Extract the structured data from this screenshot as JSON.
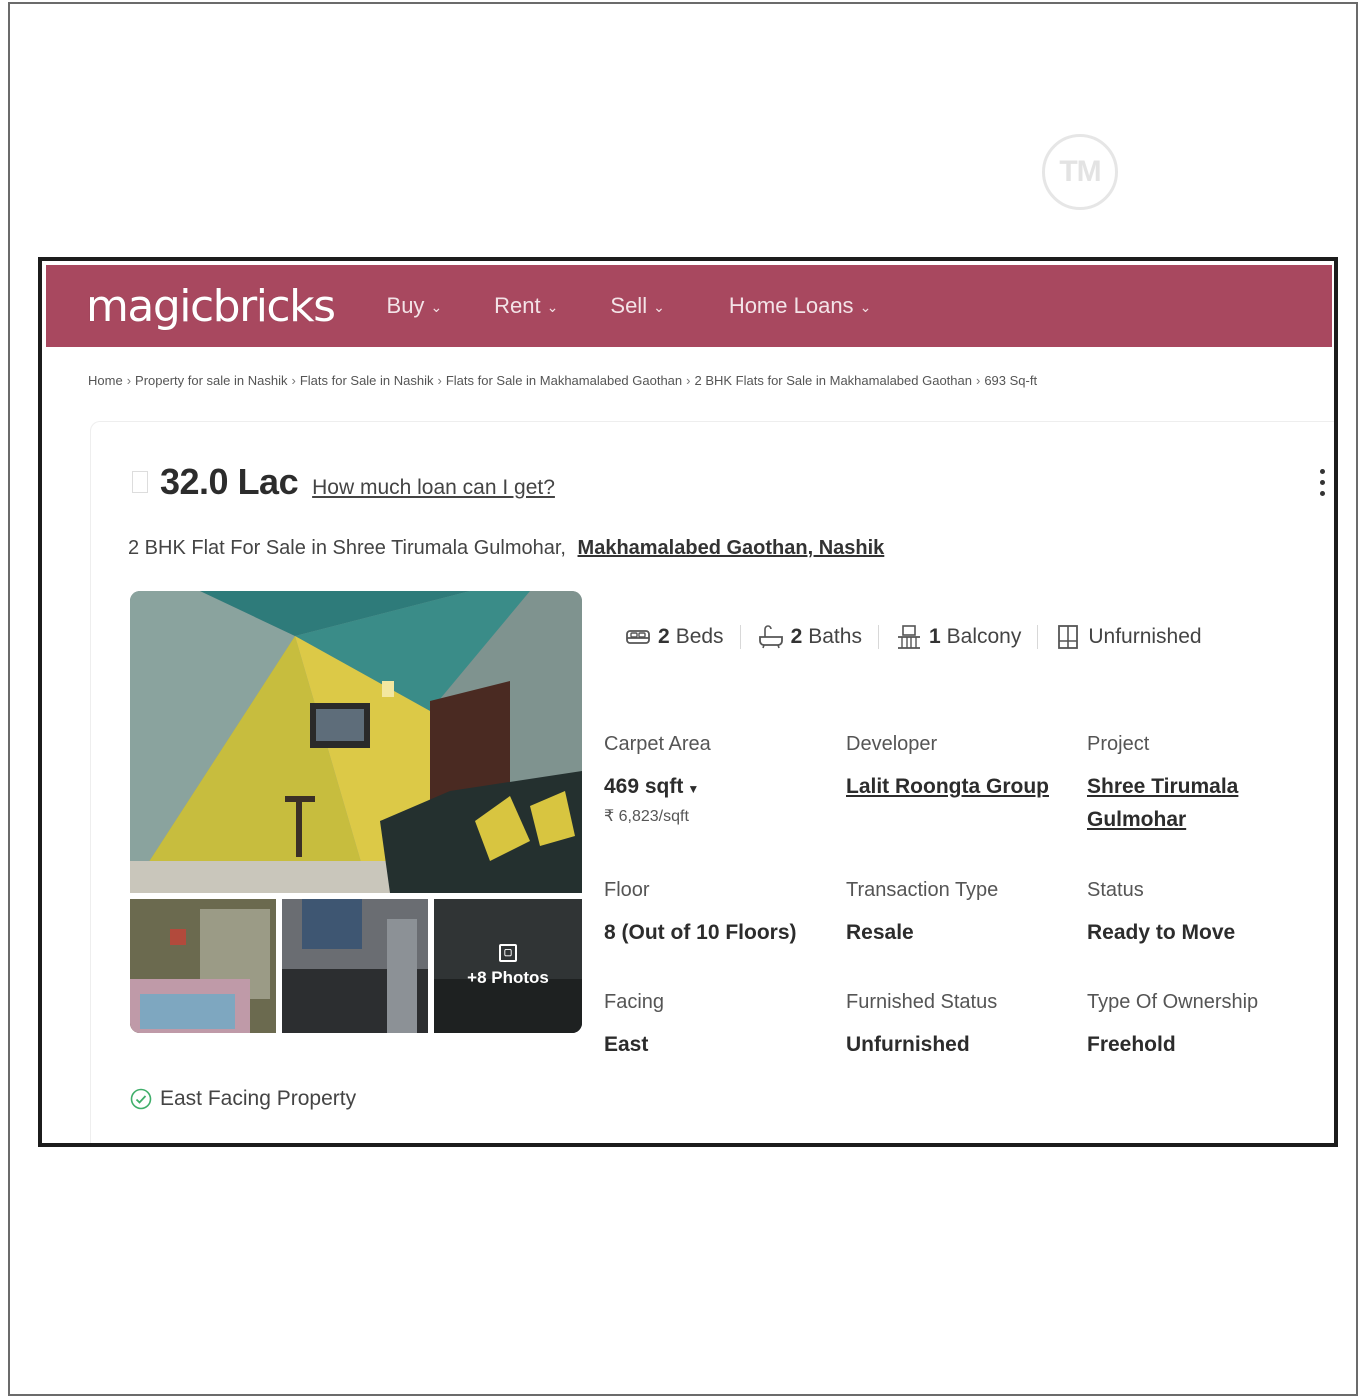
{
  "watermark": {
    "tm": "TM"
  },
  "header": {
    "logo": "magicbricks",
    "nav": [
      {
        "label": "Buy"
      },
      {
        "label": "Rent"
      },
      {
        "label": "Sell"
      },
      {
        "label": "Home Loans"
      }
    ]
  },
  "breadcrumb": [
    "Home",
    "Property for sale in Nashik",
    "Flats for Sale in Nashik",
    "Flats for Sale in Makhamalabed Gaothan",
    "2 BHK Flats for Sale in Makhamalabed Gaothan",
    "693 Sq-ft"
  ],
  "listing": {
    "price": "32.0 Lac",
    "loan_link": "How much loan can I get?",
    "subtitle": "2 BHK Flat For Sale in Shree Tirumala Gulmohar,",
    "location": "Makhamalabed Gaothan, Nashik",
    "more_photos": "+8 Photos",
    "amenities": {
      "beds_count": "2",
      "beds_label": "Beds",
      "baths_count": "2",
      "baths_label": "Baths",
      "balcony_count": "1",
      "balcony_label": "Balcony",
      "furnishing": "Unfurnished"
    },
    "details": {
      "carpet_area": {
        "label": "Carpet Area",
        "value": "469 sqft",
        "sub": "₹ 6,823/sqft"
      },
      "developer": {
        "label": "Developer",
        "value": "Lalit Roongta Group"
      },
      "project": {
        "label": "Project",
        "value_line1": "Shree Tirumala",
        "value_line2": "Gulmohar"
      },
      "floor": {
        "label": "Floor",
        "value": "8 (Out of 10 Floors)"
      },
      "transaction": {
        "label": "Transaction Type",
        "value": "Resale"
      },
      "status": {
        "label": "Status",
        "value": "Ready to Move"
      },
      "facing": {
        "label": "Facing",
        "value": "East"
      },
      "furnished_status": {
        "label": "Furnished Status",
        "value": "Unfurnished"
      },
      "ownership": {
        "label": "Type Of Ownership",
        "value": "Freehold"
      }
    },
    "badge": "East Facing Property"
  },
  "colors": {
    "brand": "#a8485f",
    "check": "#3fae6a"
  }
}
